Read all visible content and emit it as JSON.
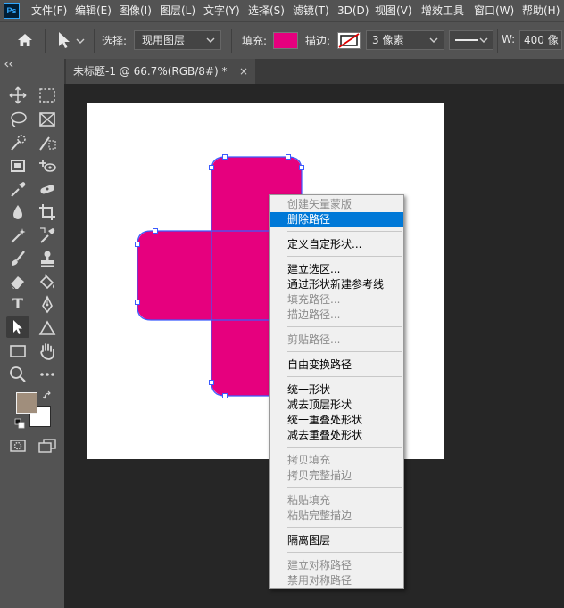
{
  "app": {
    "logo": "Ps"
  },
  "menubar": {
    "items": [
      "文件(F)",
      "编辑(E)",
      "图像(I)",
      "图层(L)",
      "文字(Y)",
      "选择(S)",
      "滤镜(T)",
      "3D(D)",
      "视图(V)",
      "增效工具",
      "窗口(W)",
      "帮助(H)"
    ]
  },
  "options": {
    "select_label": "选择:",
    "select_value": "现用图层",
    "fill_label": "填充:",
    "fill_color": "#e6007e",
    "stroke_label": "描边:",
    "stroke_width": "3 像素",
    "w_label": "W:",
    "w_value": "400 像"
  },
  "tab": {
    "title": "未标题-1 @ 66.7%(RGB/8#) *",
    "close": "×"
  },
  "shape": {
    "fill": "#e6007e",
    "path_color": "#3b5bff"
  },
  "swatches": {
    "foreground": "#a08e7c",
    "background": "#ffffff"
  },
  "context_menu": {
    "items": [
      {
        "label": "创建矢量蒙版",
        "disabled": true
      },
      {
        "label": "删除路径",
        "highlighted": true
      },
      {
        "label": "定义自定形状..."
      },
      {
        "label": "建立选区..."
      },
      {
        "label": "通过形状新建参考线"
      },
      {
        "label": "填充路径...",
        "disabled": true
      },
      {
        "label": "描边路径...",
        "disabled": true
      },
      {
        "label": "剪贴路径...",
        "disabled": true
      },
      {
        "label": "自由变换路径"
      },
      {
        "label": "统一形状"
      },
      {
        "label": "减去顶层形状"
      },
      {
        "label": "统一重叠处形状"
      },
      {
        "label": "减去重叠处形状"
      },
      {
        "label": "拷贝填充",
        "disabled": true
      },
      {
        "label": "拷贝完整描边",
        "disabled": true
      },
      {
        "label": "粘贴填充",
        "disabled": true
      },
      {
        "label": "粘贴完整描边",
        "disabled": true
      },
      {
        "label": "隔离图层"
      },
      {
        "label": "建立对称路径",
        "disabled": true
      },
      {
        "label": "禁用对称路径",
        "disabled": true
      }
    ]
  }
}
